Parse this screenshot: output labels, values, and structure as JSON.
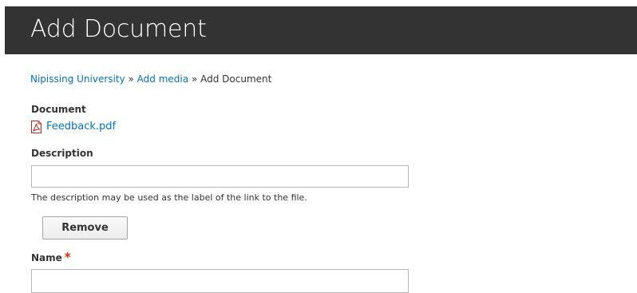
{
  "header": {
    "title": "Add Document"
  },
  "breadcrumb": {
    "items": [
      {
        "label": "Nipissing University"
      },
      {
        "label": "Add media"
      }
    ],
    "separator": "»",
    "current": "Add Document"
  },
  "document_field": {
    "label": "Document",
    "file_name": "Feedback.pdf",
    "file_icon": "pdf-file-icon"
  },
  "description_field": {
    "label": "Description",
    "value": "",
    "help_text": "The description may be used as the label of the link to the file."
  },
  "remove_button": {
    "label": "Remove"
  },
  "name_field": {
    "label": "Name",
    "required_marker": "*",
    "value": ""
  },
  "colors": {
    "header_bg": "#333333",
    "link": "#0074bd",
    "required": "#e62600"
  }
}
